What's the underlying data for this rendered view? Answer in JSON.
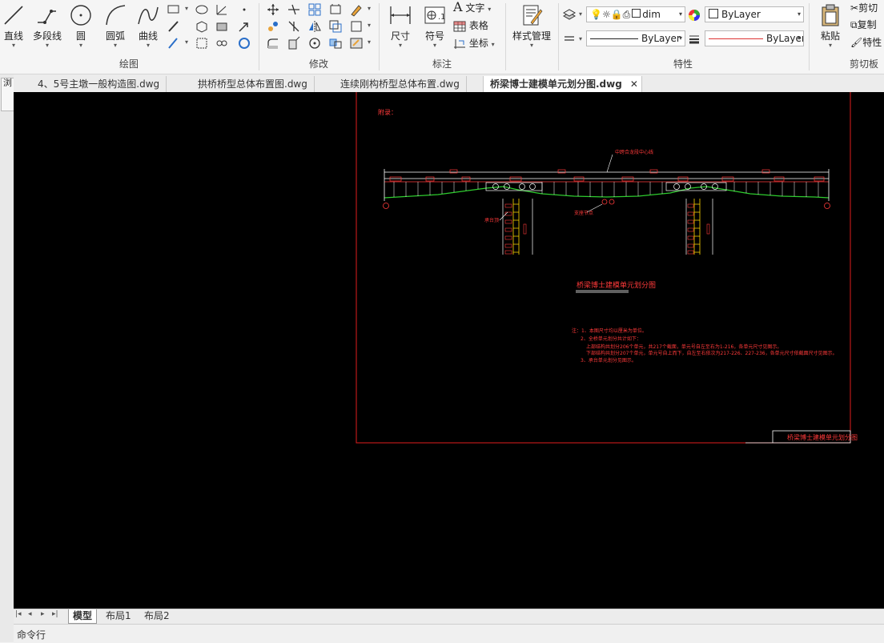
{
  "ribbon": {
    "draw_panel": {
      "title": "绘图",
      "line": "直线",
      "polyline": "多段线",
      "circle": "圆",
      "arc": "圆弧",
      "curve": "曲线"
    },
    "modify_panel": {
      "title": "修改"
    },
    "annotate_panel": {
      "title": "标注",
      "dimension": "尺寸",
      "symbol": "符号",
      "text": "文字",
      "table": "表格",
      "coordinate": "坐标"
    },
    "style_panel": {
      "style_manager": "样式管理"
    },
    "properties_panel": {
      "title": "特性",
      "layer_name": "dim",
      "color_value": "ByLayer",
      "linetype_value": "ByLayer",
      "lineweight_value": "ByLayer"
    },
    "clipboard_panel": {
      "title": "剪切板",
      "paste": "粘贴",
      "cut": "剪切",
      "copy": "复制",
      "properties": "特性"
    }
  },
  "left_strip": {
    "label": "浏"
  },
  "document_tabs": [
    {
      "label": "4、5号主墩一般构造图.dwg"
    },
    {
      "label": "拱桥桥型总体布置图.dwg"
    },
    {
      "label": "连续刚构桥型总体布置.dwg"
    },
    {
      "label": "桥梁博士建模单元划分图.dwg"
    }
  ],
  "drawing": {
    "attachment_label": "附录：",
    "title": "桥梁博士建模单元划分图",
    "title_block_text": "桥梁博士建模单元划分图",
    "top_callout": "中跨合龙段中心线",
    "left_callout": "承台顶",
    "mid_callout": "支座节点",
    "notes": [
      "注：1、本图尺寸均以厘米为单位。",
      "2、全桥单元划分共计如下：",
      "上部结构共划分206个单元，共217个截面，单元号自左至右为1-216，各单元尺寸见图示。",
      "下部结构共划分207个单元，单元号自上而下，自左至右依次为217-226、227-236，各单元尺寸依截面尺寸见图示。",
      "3、承台单元划分见图示。"
    ]
  },
  "layout_tabs": [
    {
      "label": "模型"
    },
    {
      "label": "布局1"
    },
    {
      "label": "布局2"
    }
  ],
  "command_line": {
    "label": "命令行"
  }
}
